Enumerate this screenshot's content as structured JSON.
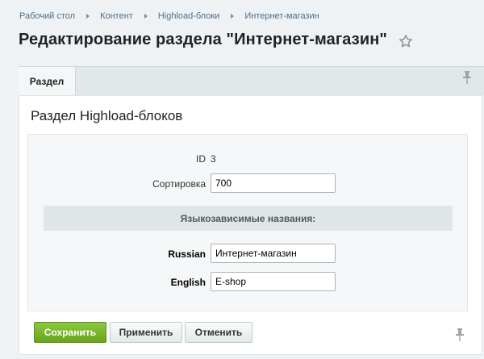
{
  "breadcrumb": [
    "Рабочий стол",
    "Контент",
    "Highload-блоки",
    "Интернет-магазин"
  ],
  "page": {
    "title": "Редактирование раздела \"Интернет-магазин\""
  },
  "tabs": [
    {
      "label": "Раздел",
      "active": true
    }
  ],
  "card": {
    "title": "Раздел Highload-блоков",
    "id_label": "ID",
    "id_value": "3",
    "sort_label": "Сортировка",
    "sort_value": "700",
    "section_heading": "Языкозависимые названия:",
    "langs": [
      {
        "label": "Russian",
        "value": "Интернет-магазин"
      },
      {
        "label": "English",
        "value": "E-shop"
      }
    ]
  },
  "buttons": {
    "save": "Сохранить",
    "apply": "Применить",
    "cancel": "Отменить"
  },
  "colors": {
    "accent_green": "#7ab72f",
    "link": "#4f6d8a",
    "background": "#eef2f4"
  },
  "icons": [
    "star-icon",
    "pin-icon"
  ]
}
